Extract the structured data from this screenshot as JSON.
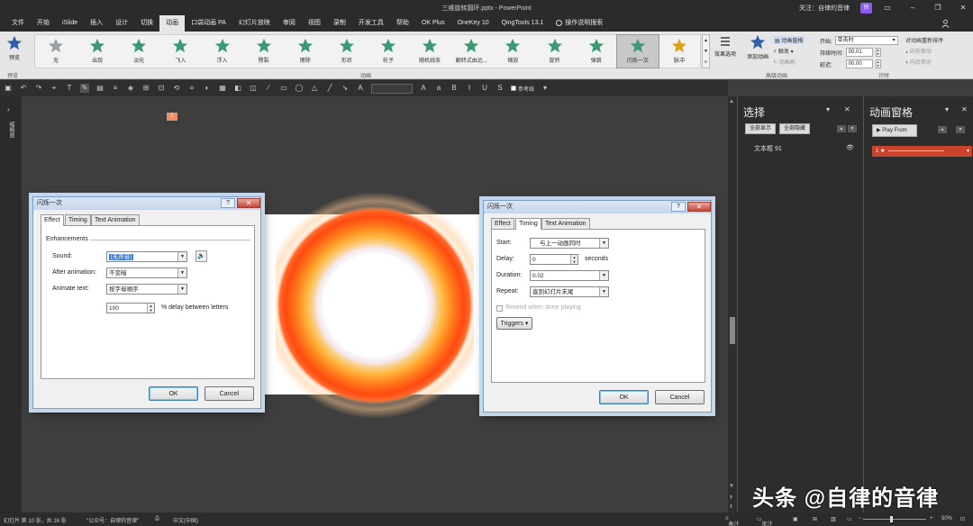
{
  "window": {
    "title": "三维旋转圆环.pptx  -  PowerPoint",
    "user_label": "关注：自律的音律",
    "badge": "徐"
  },
  "tabs": [
    "文件",
    "开始",
    "iSlide",
    "插入",
    "设计",
    "切换",
    "动画",
    "口袋动画 PA",
    "幻灯片放映",
    "审阅",
    "视图",
    "录制",
    "开发工具",
    "帮助",
    "OK Plus",
    "OneKey 10",
    "QingTools 13.1",
    "操作说明搜索"
  ],
  "active_tab": "动画",
  "ribbon": {
    "preview_label": "预览",
    "preview_group": "预览",
    "animation_group": "动画",
    "effects": [
      "无",
      "出现",
      "淡化",
      "飞入",
      "浮入",
      "劈裂",
      "擦除",
      "形状",
      "轮子",
      "随机线条",
      "翻转式由远...",
      "缩放",
      "旋转",
      "弹跳",
      "闪烁一次",
      "脉冲"
    ],
    "selected_effect": "闪烁一次",
    "effect_options_label": "效果选项",
    "advanced_group": "高级动画",
    "add_animation": "添加动画",
    "animation_pane": "动画窗格",
    "trigger": "触发",
    "animation_painter": "动画刷",
    "timing_group": "计时",
    "start_label": "开始:",
    "start_value": "单击时",
    "duration_label": "持续时间:",
    "duration_value": "00.01",
    "delay_label": "延迟:",
    "delay_value": "00.00",
    "reorder_title": "对动画重新排序",
    "move_earlier": "向前移动",
    "move_later": "向后移动"
  },
  "qat": {
    "ref_lines": "参考线"
  },
  "left_panel": {
    "label": "缩略图"
  },
  "slide": {
    "badge": "1"
  },
  "selection_pane": {
    "title": "选择",
    "show_all": "全部显示",
    "hide_all": "全部隐藏",
    "items": [
      "文本框 91"
    ]
  },
  "animation_pane": {
    "title": "动画窗格",
    "play_from": "Play From",
    "item_index": "1"
  },
  "dialog_effect": {
    "title": "闪烁一次",
    "tabs": [
      "Effect",
      "Timing",
      "Text Animation"
    ],
    "section": "Enhancements",
    "sound_label": "Sound:",
    "sound_value": "[无声音]",
    "after_label": "After animation:",
    "after_value": "不变暗",
    "animate_text_label": "Animate text:",
    "animate_text_value": "按字母顺序",
    "delay_value": "100",
    "delay_suffix": "% delay between letters",
    "ok": "OK",
    "cancel": "Cancel"
  },
  "dialog_timing": {
    "title": "闪烁一次",
    "tabs": [
      "Effect",
      "Timing",
      "Text Animation"
    ],
    "start_label": "Start:",
    "start_value": "与上一动画同时",
    "delay_label": "Delay:",
    "delay_value": "0",
    "delay_unit": "seconds",
    "duration_label": "Duration:",
    "duration_value": "0.02",
    "repeat_label": "Repeat:",
    "repeat_value": "直到幻灯片末尾",
    "rewind_label": "Rewind when done playing",
    "triggers": "Triggers",
    "ok": "OK",
    "cancel": "Cancel"
  },
  "statusbar": {
    "slide_info": "幻灯片 第 10 张，共 16 张",
    "theme": "\"公众号：自律的音律\"",
    "language": "中文(中国)",
    "notes": "备注",
    "comments": "批注",
    "zoom": "50%"
  },
  "watermark": "头条 @自律的音律",
  "colors": {
    "accent_red": "#c8442b",
    "ring_orange": "#ff5a10"
  }
}
